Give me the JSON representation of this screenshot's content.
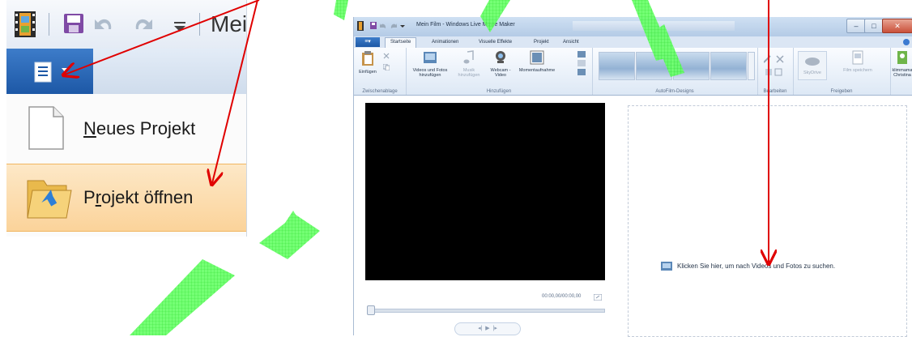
{
  "zoom": {
    "title_fragment": "Mei",
    "menu_items": [
      {
        "label": "Neues Projekt",
        "hotkey": "N",
        "rest": "eues Projekt"
      },
      {
        "label": "Projekt öffnen",
        "pre": "P",
        "hotkey": "r",
        "rest": "ojekt öffnen"
      }
    ]
  },
  "window": {
    "title": "Mein Film - Windows Live Movie Maker",
    "file_tab": "▾",
    "tabs": [
      "Startseite",
      "Animationen",
      "Visuelle Effekte",
      "Projekt",
      "Ansicht"
    ],
    "ribbon": {
      "paste": "Einfügen",
      "clipboard_group": "Zwischenablage",
      "add_videos": "Videos und Fotos hinzufügen",
      "music": "Musik hinzufügen",
      "webcam": "Webcam -Video",
      "snapshot": "Momentaufnahme",
      "add_group": "Hinzufügen",
      "autofilm_group": "AutoFilm-Designs",
      "edit_group": "Bearbeiten",
      "skydrive": "SkyDrive",
      "save_movie": "Film speichern",
      "share_group": "Freigeben",
      "user": "klimmama Christina"
    },
    "timecode": "00:00,00/00:00,00",
    "storyboard_hint": "Klicken Sie hier, um nach Videos und Fotos zu suchen."
  },
  "colors": {
    "accent": "#1d58a6",
    "arrow": "#e00000",
    "highlight": "#fbd39a",
    "watermark": "#33ff33"
  }
}
